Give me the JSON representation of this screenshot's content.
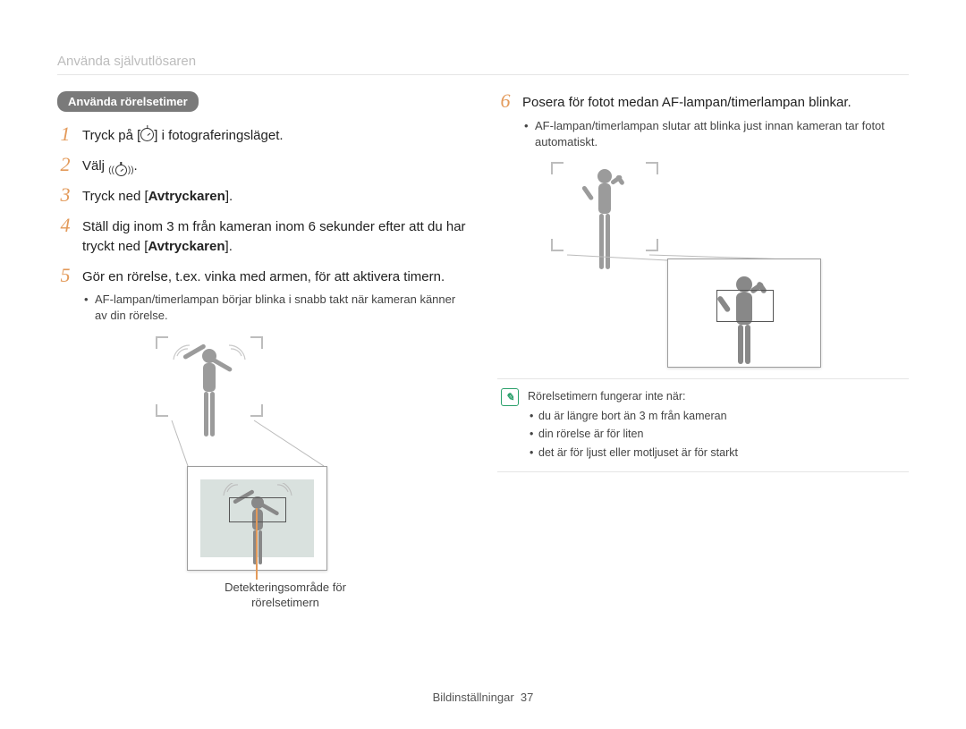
{
  "header": {
    "running_head": "Använda självutlösaren"
  },
  "pill": {
    "label": "Använda rörelsetimer"
  },
  "icons": {
    "timer_box": "timer-icon",
    "timer_waves": "motion-timer-icon"
  },
  "steps_left": [
    {
      "num": "1",
      "pre": "Tryck på [",
      "post": "] i fotograferingsläget."
    },
    {
      "num": "2",
      "pre": "Välj ",
      "post": "."
    },
    {
      "num": "3",
      "pre": "Tryck ned [",
      "bold": "Avtryckaren",
      "post": "]."
    },
    {
      "num": "4",
      "line": "Ställ dig inom 3 m från kameran inom 6 sekunder efter att du har tryckt ned [",
      "bold": "Avtryckaren",
      "tail": "]."
    },
    {
      "num": "5",
      "line": "Gör en rörelse, t.ex. vinka med armen, för att aktivera timern.",
      "sub": [
        "AF-lampan/timerlampan börjar blinka i snabb takt när kameran känner av din rörelse."
      ]
    }
  ],
  "fig_left": {
    "caption": "Detekteringsområde för rörelsetimern"
  },
  "steps_right": [
    {
      "num": "6",
      "line": "Posera för fotot medan AF-lampan/timerlampan blinkar.",
      "sub": [
        "AF-lampan/timerlampan slutar att blinka just innan kameran tar fotot automatiskt."
      ]
    }
  ],
  "note": {
    "lead": "Rörelsetimern fungerar inte när:",
    "items": [
      "du är längre bort än 3 m från kameran",
      "din rörelse är för liten",
      "det är för ljust eller motljuset är för starkt"
    ]
  },
  "footer": {
    "section": "Bildinställningar",
    "page": "37"
  }
}
